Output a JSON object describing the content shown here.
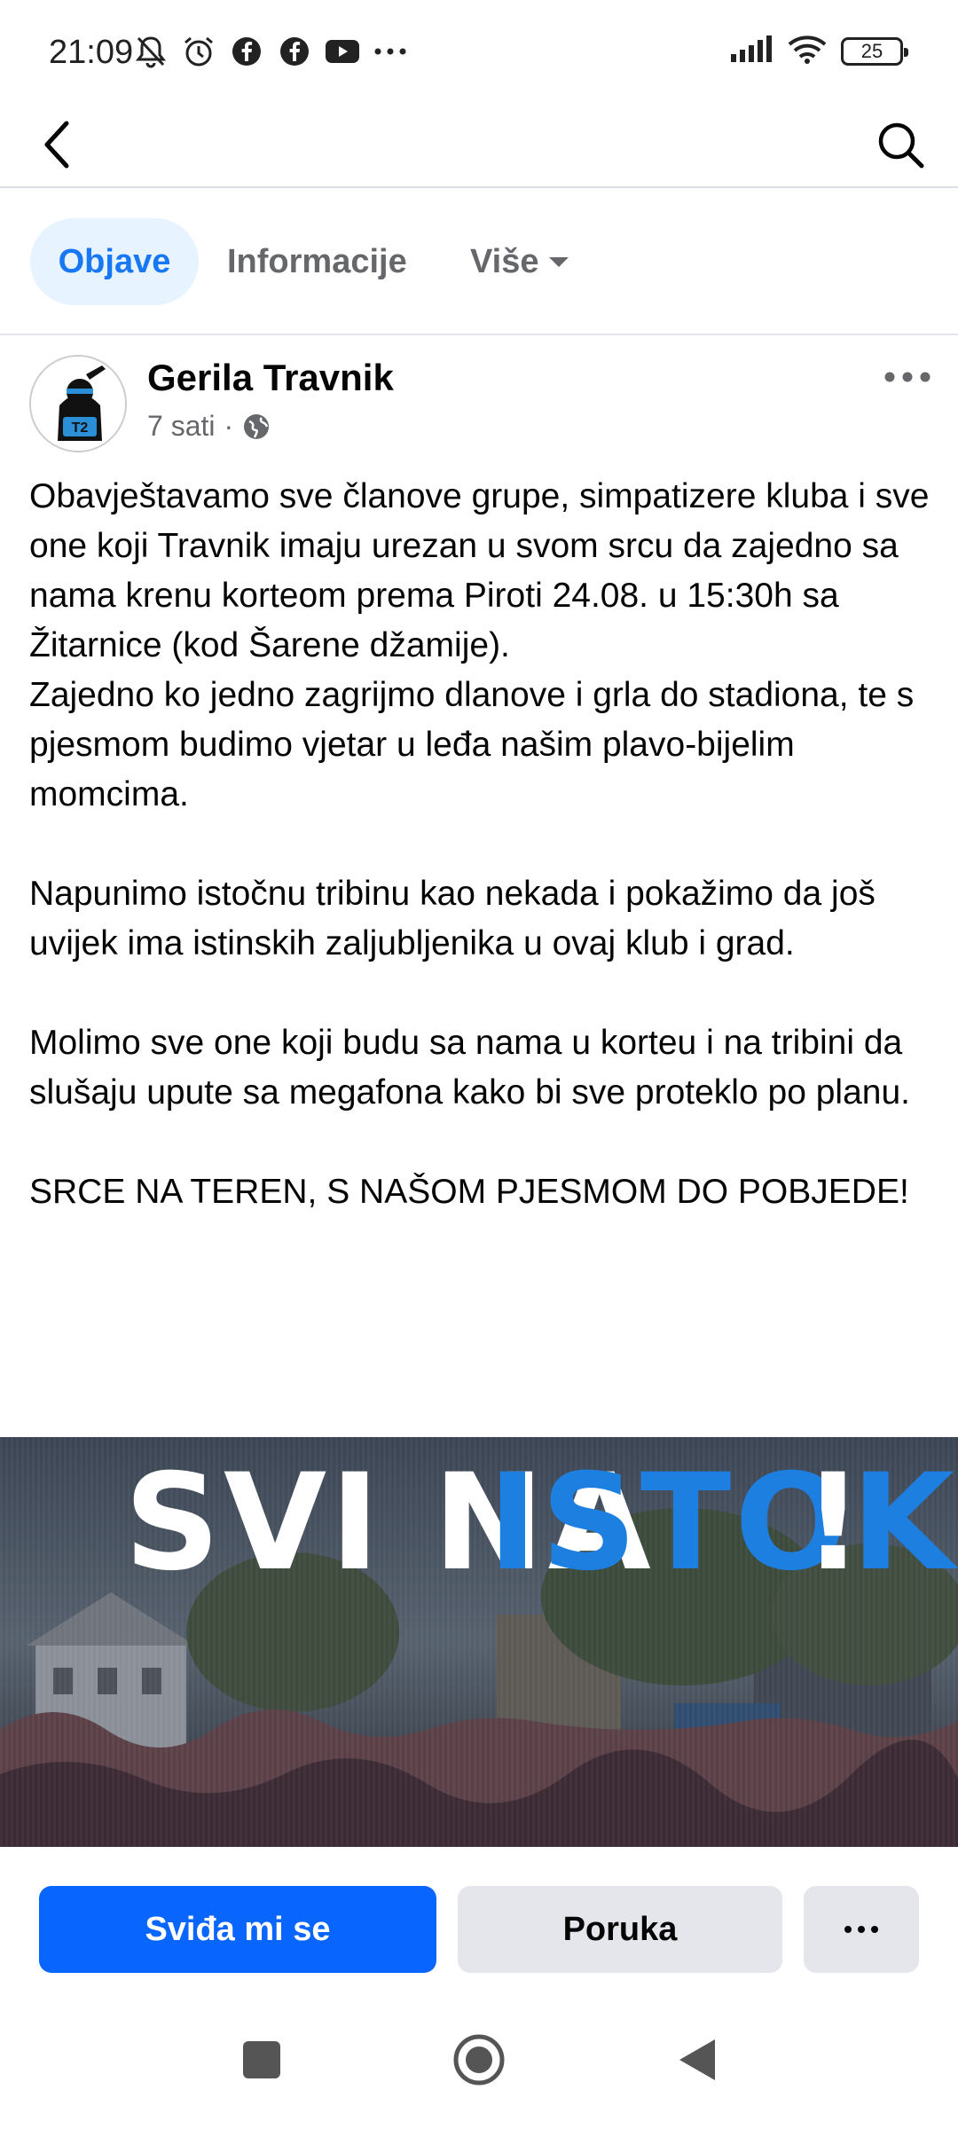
{
  "status_bar": {
    "time": "21:09",
    "battery": "25",
    "icons": [
      "notifications-off-icon",
      "alarm-icon",
      "facebook-icon",
      "facebook-icon",
      "youtube-icon",
      "more-icon",
      "signal-icon",
      "wifi-icon",
      "battery-icon"
    ]
  },
  "tabs": [
    {
      "label": "Objave",
      "active": true
    },
    {
      "label": "Informacije",
      "active": false
    },
    {
      "label": "Više",
      "active": false
    }
  ],
  "post": {
    "author": "Gerila Travnik",
    "time": "7 sati",
    "separator": "·",
    "text": "Obavještavamo sve članove grupe, simpatizere kluba i sve one koji Travnik imaju urezan u svom srcu da zajedno sa nama krenu korteom prema Piroti 24.08. u 15:30h sa Žitarnice (kod Šarene džamije).\nZajedno ko jedno zagrijmo dlanove i grla do stadiona, te s pjesmom budimo vjetar u leđa našim plavo-bijelim momcima.\n\nNapunimo istočnu tribinu kao nekada i pokažimo da još uvijek ima istinskih zaljubljenika u ovaj klub i grad.\n\nMolimo sve one koji budu sa nama u korteu i na tribini da slušaju upute sa megafona kako bi sve proteklo po planu.\n\nSRCE NA TEREN, S NAŠOM PJESMOM DO POBJEDE!",
    "image": {
      "word1": "SVI NA",
      "word2": "ISTOK",
      "word3": "!"
    }
  },
  "actions": {
    "like_label": "Sviđa mi se",
    "message_label": "Poruka"
  },
  "colors": {
    "primary": "#0866ff",
    "tab_active_bg": "#e7f3ff",
    "tab_active_text": "#1877f2",
    "secondary_btn": "#e4e6eb",
    "banner_blue": "#1d7fe0"
  }
}
